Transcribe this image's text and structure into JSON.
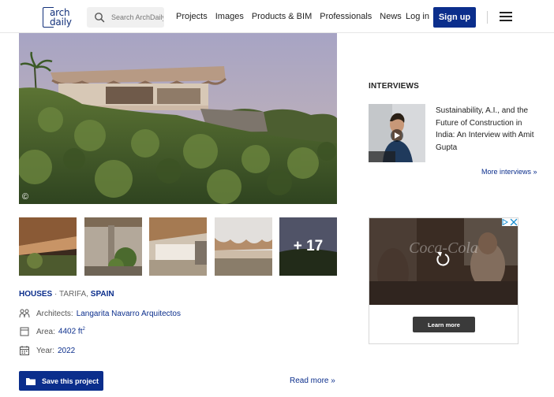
{
  "header": {
    "logo_line1": "arch",
    "logo_line2": "daily",
    "search_placeholder": "Search ArchDaily",
    "nav": [
      "Projects",
      "Images",
      "Products & BIM",
      "Professionals",
      "News"
    ],
    "login_label": "Log in",
    "signup_label": "Sign up",
    "brand_color": "#0b2e8c"
  },
  "hero": {
    "copyright_symbol": "©"
  },
  "thumbnails": {
    "more_label": "+ 17"
  },
  "project": {
    "category": "HOUSES",
    "separator": " · ",
    "location_prefix": "TARIFA, ",
    "country": "SPAIN",
    "architects_label": "Architects:",
    "architects_value": "Langarita Navarro Arquitectos",
    "area_label": "Area:",
    "area_value": "4402 ft",
    "area_unit_sup": "2",
    "year_label": "Year:",
    "year_value": "2022",
    "save_label": "Save this project",
    "read_more_label": "Read more »"
  },
  "sidebar": {
    "interviews_heading": "INTERVIEWS",
    "interview_title": "Sustainability, A.I., and the Future of Construction in India: An Interview with Amit Gupta",
    "more_interviews_label": "More interviews »"
  },
  "ad": {
    "cta_label": "Learn more"
  }
}
